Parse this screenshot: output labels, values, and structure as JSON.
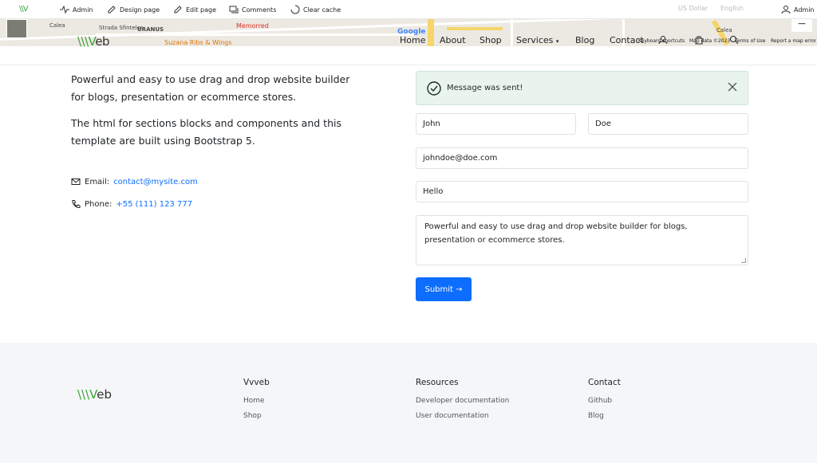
{
  "admin_bar": {
    "logo": "\\\\V",
    "items": [
      {
        "label": "Admin",
        "icon": "activity-icon"
      },
      {
        "label": "Design page",
        "icon": "pencil-icon"
      },
      {
        "label": "Edit page",
        "icon": "pencil-icon"
      },
      {
        "label": "Comments",
        "icon": "comments-icon"
      },
      {
        "label": "Clear cache",
        "icon": "circle-icon"
      }
    ],
    "user": "Admin",
    "map_extra": [
      "US Dollar",
      "English"
    ]
  },
  "map": {
    "labels": [
      "Calea",
      "Strada Sfintelor",
      "URANUS",
      "Memorred",
      "Suzana Ribs & Wings",
      "Calea"
    ],
    "google": "Google",
    "attribution": [
      "Keyboard shortcuts",
      "Map data ©2023",
      "Terms of Use",
      "Report a map error"
    ]
  },
  "site": {
    "logo_a": "\\\\\\V",
    "logo_b": "eb",
    "nav": [
      "Home",
      "About",
      "Shop",
      "Services",
      "Blog",
      "Contact"
    ]
  },
  "content": {
    "lead1": "Powerful and easy to use drag and drop website builder for blogs, presentation or ecommerce stores.",
    "lead2": "The html for sections blocks and components and this template are built using Bootstrap 5.",
    "email_label": "Email:",
    "email": "contact@mysite.com",
    "phone_label": "Phone:",
    "phone": "+55 (111) 123 777"
  },
  "form": {
    "alert": "Message was sent!",
    "first_name": "John",
    "last_name": "Doe",
    "email": "johndoe@doe.com",
    "subject": "Hello",
    "message": " Powerful and easy to use drag and drop website builder for blogs, presentation or ecommerce stores.",
    "submit": "Submit →"
  },
  "footer": {
    "logo_a": "\\\\\\V",
    "logo_b": "eb",
    "columns": [
      {
        "title": "Vvveb",
        "links": [
          "Home",
          "Shop"
        ]
      },
      {
        "title": "Resources",
        "links": [
          "Developer documentation",
          "User documentation"
        ]
      },
      {
        "title": "Contact",
        "links": [
          "Github",
          "Blog"
        ]
      }
    ]
  },
  "colors": {
    "accent": "#0d6efd",
    "brand": "#3ca33c",
    "alert_bg": "#e9f4ef",
    "footer_bg": "#f5f6f8"
  }
}
